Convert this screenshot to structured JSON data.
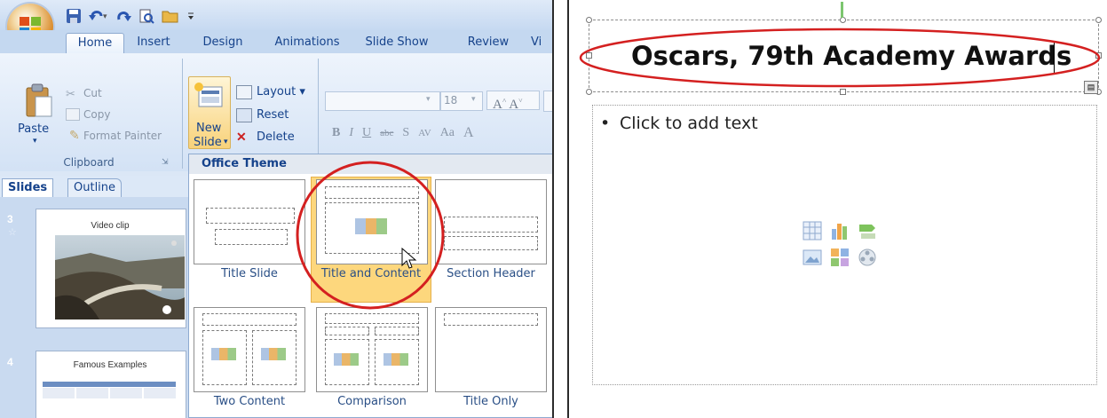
{
  "ribbon": {
    "tabs": [
      "Home",
      "Insert",
      "Design",
      "Animations",
      "Slide Show",
      "Review",
      "Vi"
    ],
    "clipboard": {
      "paste": "Paste",
      "cut": "Cut",
      "copy": "Copy",
      "format_painter": "Format Painter",
      "group_label": "Clipboard"
    },
    "slides": {
      "new_slide_line1": "New",
      "new_slide_line2": "Slide",
      "layout": "Layout",
      "reset": "Reset",
      "delete": "Delete"
    },
    "font": {
      "size": "18"
    }
  },
  "pane": {
    "tabs": [
      "Slides",
      "Outline"
    ],
    "thumbnails": [
      {
        "number": "3",
        "title": "Video clip"
      },
      {
        "number": "4",
        "title": "Famous Examples"
      }
    ]
  },
  "layout_gallery": {
    "header": "Office Theme",
    "layouts": [
      "Title Slide",
      "Title and Content",
      "Section Header",
      "Two Content",
      "Comparison",
      "Title Only"
    ],
    "selected": "Title and Content"
  },
  "slide": {
    "title": "Oscars, 79th Academy Awards",
    "bullet": "•",
    "placeholder_text": "Click to add text"
  },
  "colors": {
    "annotation_circle": "#d42020",
    "ribbon_text": "#15428b",
    "selected_layout": "#fdd77d"
  },
  "icons": [
    "office-button-icon",
    "save-icon",
    "undo-icon",
    "redo-icon",
    "print-preview-icon",
    "open-icon",
    "mouse-cursor-icon",
    "table-icon",
    "chart-icon",
    "smartart-icon",
    "picture-icon",
    "clipart-icon",
    "media-icon"
  ]
}
